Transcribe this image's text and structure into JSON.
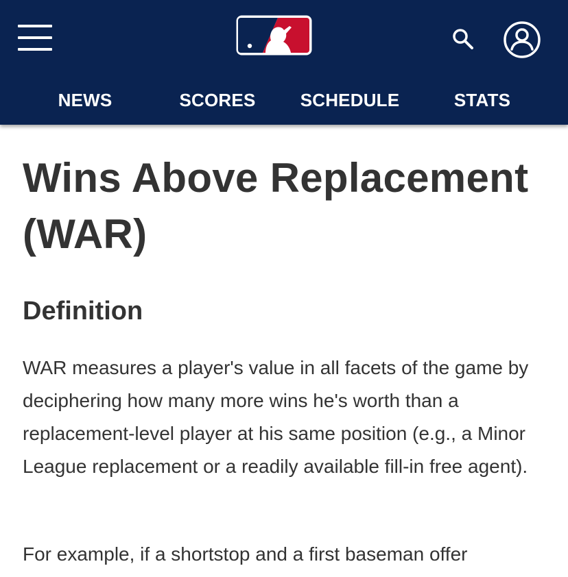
{
  "header": {
    "brand": "MLB",
    "nav": [
      {
        "label": "NEWS"
      },
      {
        "label": "SCORES"
      },
      {
        "label": "SCHEDULE"
      },
      {
        "label": "STATS"
      }
    ],
    "colors": {
      "background": "#0a2351",
      "logo_red": "#c8102e",
      "logo_blue": "#0a2351"
    },
    "icons": {
      "menu": "hamburger-menu-icon",
      "search": "search-icon",
      "account": "user-account-icon"
    }
  },
  "article": {
    "title": "Wins Above Replacement (WAR)",
    "section_heading": "Definition",
    "paragraphs": [
      "WAR measures a player's value in all facets of the game by deciphering how many more wins he's worth than a replacement-level player at his same position (e.g., a Minor League replacement or a readily available fill-in free agent).",
      "For example, if a shortstop and a first baseman offer"
    ]
  }
}
